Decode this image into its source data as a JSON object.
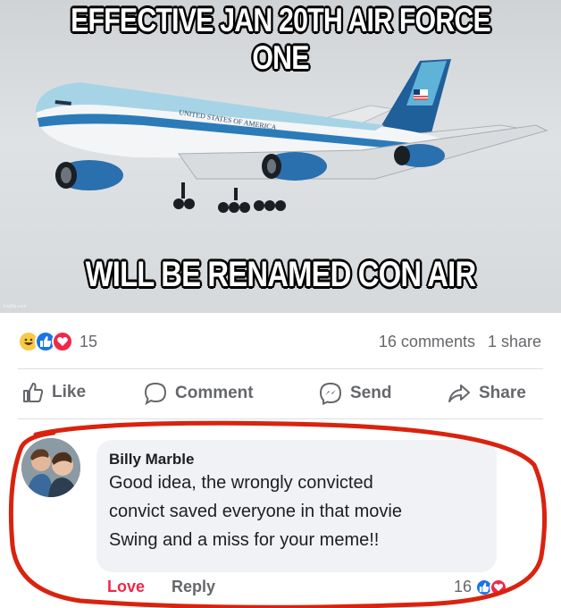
{
  "meme": {
    "top_caption": "EFFECTIVE JAN 20TH AIR FORCE ONE",
    "bottom_caption": "WILL BE RENAMED CON AIR",
    "plane_text": "UNITED STATES OF AMERICA",
    "watermark": "imgflip.com"
  },
  "stats": {
    "reaction_icons": [
      "haha-icon",
      "like-icon",
      "love-icon"
    ],
    "reaction_count": "15",
    "comments": "16 comments",
    "shares": "1 share"
  },
  "actions": {
    "like": "Like",
    "comment": "Comment",
    "send": "Send",
    "share": "Share"
  },
  "comment": {
    "author": "Billy Marble",
    "lines": [
      "Good idea, the wrongly convicted",
      "convict saved everyone in that movie",
      "Swing and a miss for your meme!!"
    ],
    "love_label": "Love",
    "reply_label": "Reply",
    "reaction_count": "16"
  },
  "colors": {
    "facebook_blue": "#1b74e4",
    "love_red": "#f02849",
    "annotation_red": "#d9230f",
    "secondary_text": "#65676b"
  }
}
